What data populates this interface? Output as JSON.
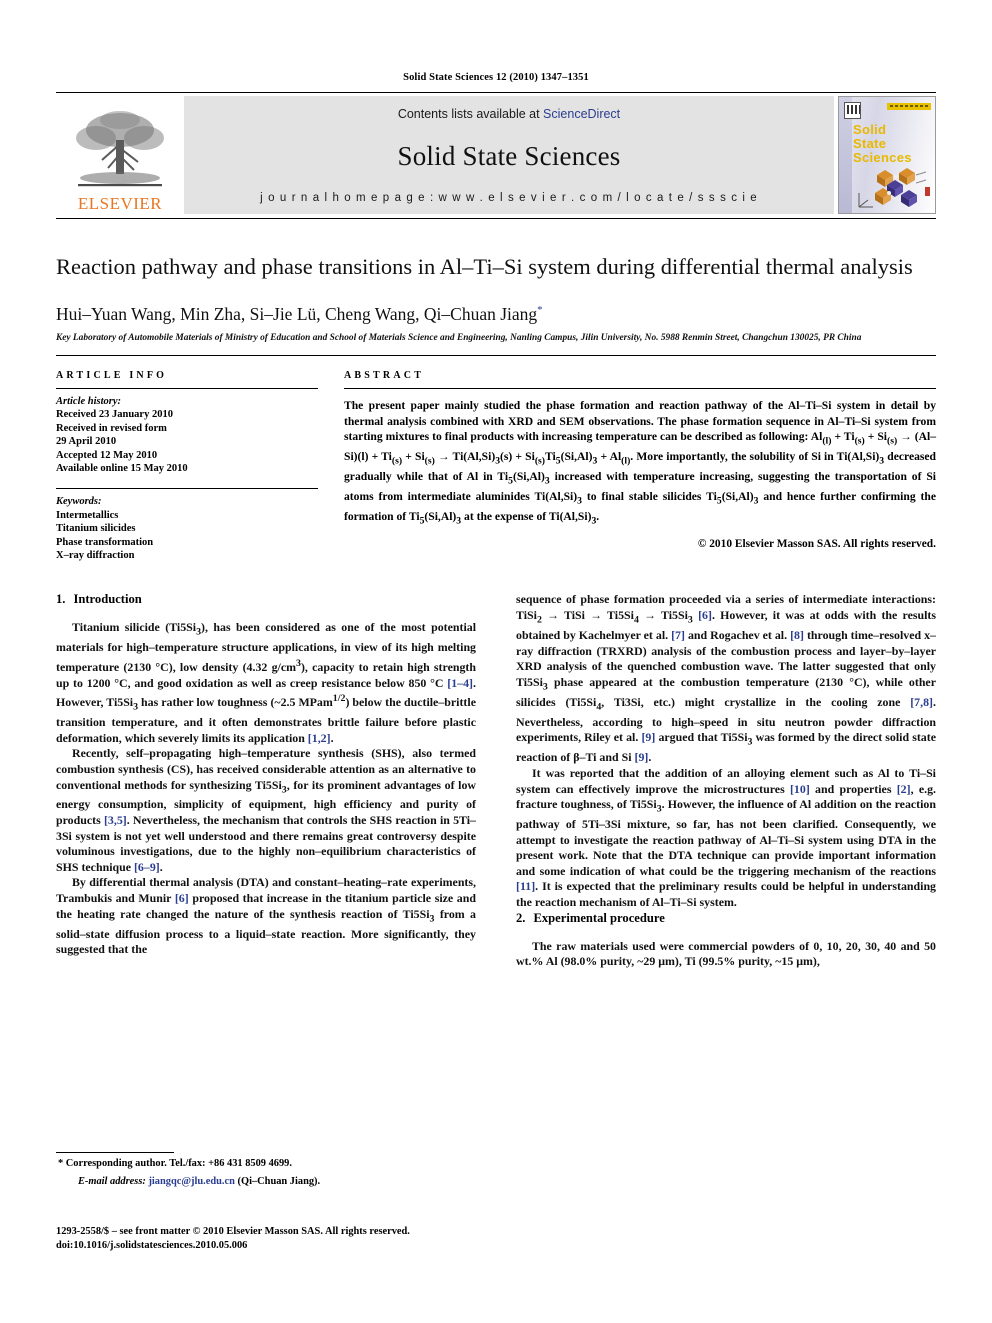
{
  "running_head": "Solid State Sciences 12 (2010) 1347–1351",
  "masthead": {
    "contents_prefix": "Contents lists available at ",
    "sciencedirect": "ScienceDirect",
    "journal_title": "Solid State Sciences",
    "homepage": "j o u r n a l   h o m e p a g e :   w w w . e l s e v i e r . c o m / l o c a t e / s s s c i e",
    "publisher": "ELSEVIER",
    "cover_title_lines": [
      "Solid",
      "State",
      "Sciences"
    ],
    "accent_orange": "#E87722",
    "link_blue": "#2b3d8f",
    "cover_yellow": "#E8B900"
  },
  "article": {
    "title": "Reaction pathway and phase transitions in Al–Ti–Si system during differential thermal analysis",
    "authors": "Hui–Yuan Wang, Min Zha, Si–Jie Lü, Cheng Wang, Qi–Chuan Jiang",
    "corresponding_marker": "*",
    "affiliation": "Key Laboratory of Automobile Materials of Ministry of Education and School of Materials Science and Engineering, Nanling Campus, Jilin University, No. 5988 Renmin Street, Changchun 130025, PR China"
  },
  "article_info": {
    "heading": "ARTICLE INFO",
    "history_label": "Article history:",
    "history": [
      "Received 23 January 2010",
      "Received in revised form",
      "29 April 2010",
      "Accepted 12 May 2010",
      "Available online 15 May 2010"
    ],
    "keywords_label": "Keywords:",
    "keywords": [
      "Intermetallics",
      "Titanium silicides",
      "Phase transformation",
      "X–ray diffraction"
    ]
  },
  "abstract": {
    "heading": "ABSTRACT",
    "text": "The present paper mainly studied the phase formation and reaction pathway of the Al–Ti–Si system in detail by thermal analysis combined with XRD and SEM observations. The phase formation sequence in Al–Ti–Si system from starting mixtures to final products with increasing temperature can be described as following: Al(l) + Ti(s) + Si(s) → (Al–Si)(l) + Ti(s) + Si(s) → Ti(Al,Si)3(s) + Si(s)Ti5(Si,Al)3 + Al(l). More importantly, the solubility of Si in Ti(Al,Si)3 decreased gradually while that of Al in Ti5(Si,Al)3 increased with temperature increasing, suggesting the transportation of Si atoms from intermediate aluminides Ti(Al,Si)3 to final stable silicides Ti5(Si,Al)3 and hence further confirming the formation of Ti5(Si,Al)3 at the expense of Ti(Al,Si)3.",
    "copyright": "© 2010 Elsevier Masson SAS. All rights reserved."
  },
  "sections": {
    "introduction": {
      "num": "1.",
      "title": "Introduction",
      "paragraphs": [
        "Titanium silicide (Ti5Si3), has been considered as one of the most potential materials for high–temperature structure applications, in view of its high melting temperature (2130 °C), low density (4.32 g/cm3), capacity to retain high strength up to 1200 °C, and good oxidation as well as creep resistance below 850 °C [1–4]. However, Ti5Si3 has rather low toughness (~2.5 MPam1/2) below the ductile–brittle transition temperature, and it often demonstrates brittle failure before plastic deformation, which severely limits its application [1,2].",
        "Recently, self–propagating high–temperature synthesis (SHS), also termed combustion synthesis (CS), has received considerable attention as an alternative to conventional methods for synthesizing Ti5Si3, for its prominent advantages of low energy consumption, simplicity of equipment, high efficiency and purity of products [3,5]. Nevertheless, the mechanism that controls the SHS reaction in 5Ti–3Si system is not yet well understood and there remains great controversy despite voluminous investigations, due to the highly non–equilibrium characteristics of SHS technique [6–9].",
        "By differential thermal analysis (DTA) and constant–heating–rate experiments, Trambukis and Munir [6] proposed that increase in the titanium particle size and the heating rate changed the nature of the synthesis reaction of Ti5Si3 from a solid–state diffusion process to a liquid–state reaction. More significantly, they suggested that the",
        "sequence of phase formation proceeded via a series of intermediate interactions: TiSi2 → TiSi → Ti5Si4 → Ti5Si3 [6]. However, it was at odds with the results obtained by Kachelmyer et al. [7] and Rogachev et al. [8] through time–resolved x–ray diffraction (TRXRD) analysis of the combustion process and layer–by–layer XRD analysis of the quenched combustion wave. The latter suggested that only Ti5Si3 phase appeared at the combustion temperature (2130 °C), while other silicides (Ti5Si4, Ti3Si, etc.) might crystallize in the cooling zone [7,8]. Nevertheless, according to high–speed in situ neutron powder diffraction experiments, Riley et al. [9] argued that Ti5Si3 was formed by the direct solid state reaction of β–Ti and Si [9].",
        "It was reported that the addition of an alloying element such as Al to Ti–Si system can effectively improve the microstructures [10] and properties [2], e.g. fracture toughness, of Ti5Si3. However, the influence of Al addition on the reaction pathway of 5Ti–3Si mixture, so far, has not been clarified. Consequently, we attempt to investigate the reaction pathway of Al–Ti–Si system using DTA in the present work. Note that the DTA technique can provide important information and some indication of what could be the triggering mechanism of the reactions [11]. It is expected that the preliminary results could be helpful in understanding the reaction mechanism of Al–Ti–Si system."
      ]
    },
    "experimental": {
      "num": "2.",
      "title": "Experimental procedure",
      "paragraphs": [
        "The raw materials used were commercial powders of 0, 10, 20, 30, 40 and 50 wt.% Al (98.0% purity, ~29 μm), Ti (99.5% purity, ~15 μm),"
      ]
    }
  },
  "footnote": {
    "corresponding": "* Corresponding author. Tel./fax: +86 431 8509 4699.",
    "email_label": "E-mail address:",
    "email": "jiangqc@jlu.edu.cn",
    "email_owner": "(Qi–Chuan Jiang).",
    "front_matter": "1293-2558/$ – see front matter © 2010 Elsevier Masson SAS. All rights reserved.",
    "doi": "doi:10.1016/j.solidstatesciences.2010.05.006"
  }
}
